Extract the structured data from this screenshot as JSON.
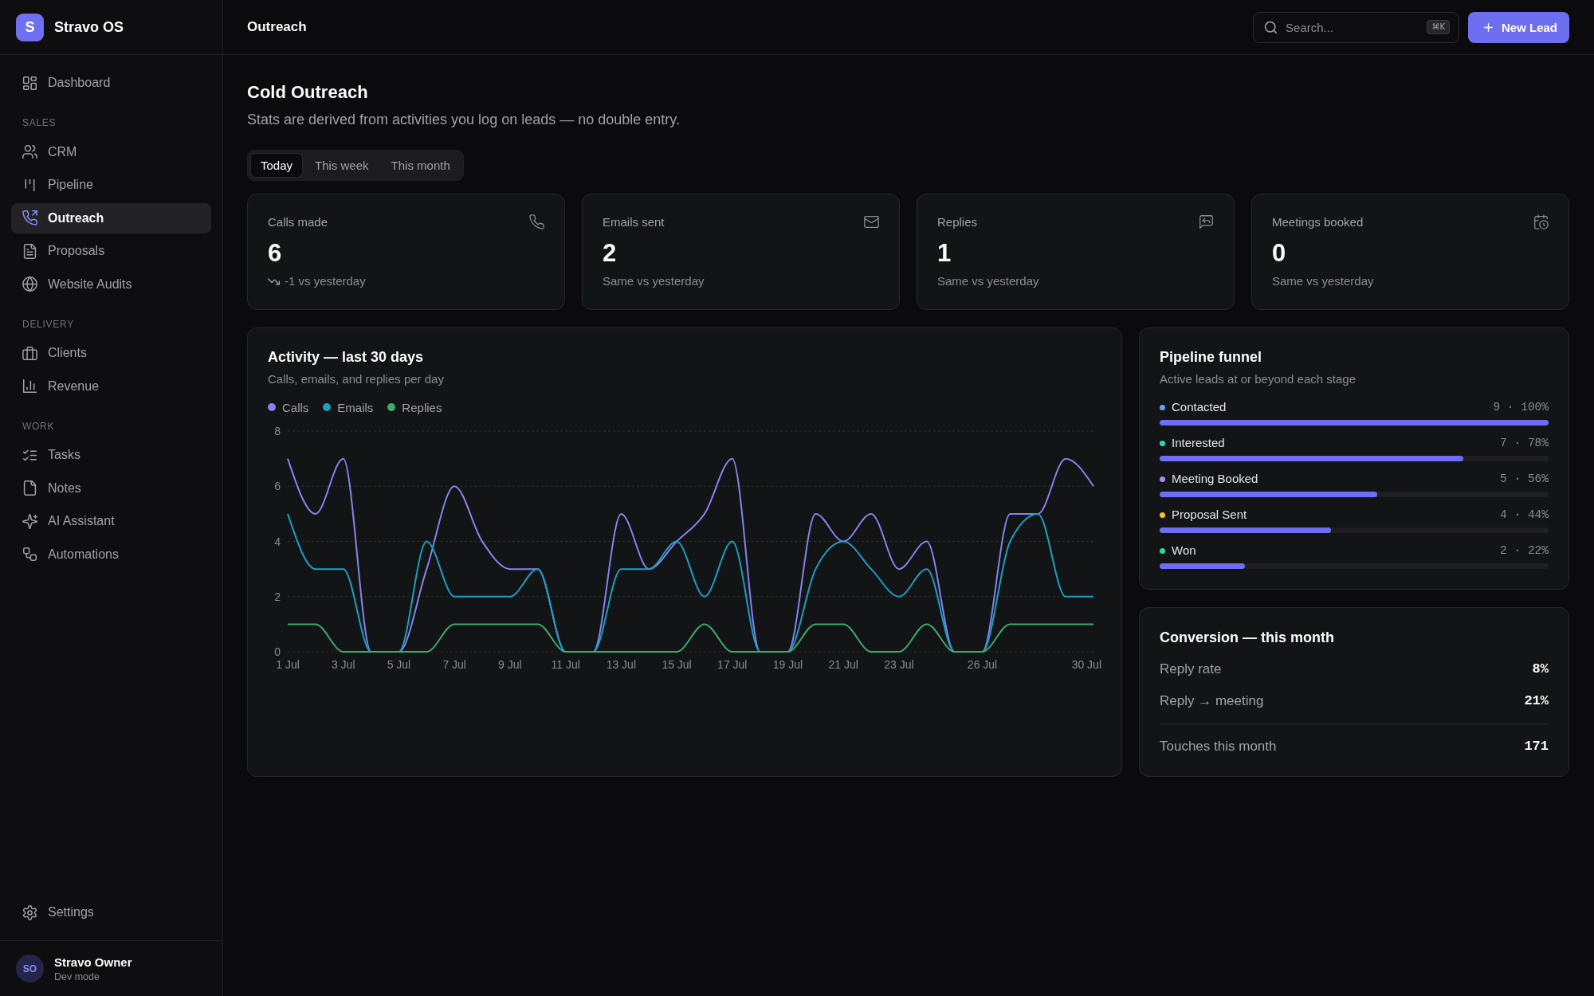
{
  "sidebar": {
    "brand": {
      "logo_letter": "S",
      "name": "Stravo OS"
    },
    "sections": [
      {
        "items": [
          {
            "label": "Dashboard",
            "selected": false
          }
        ]
      },
      {
        "heading": "SALES",
        "items": [
          {
            "label": "CRM",
            "selected": false
          },
          {
            "label": "Pipeline",
            "selected": false
          },
          {
            "label": "Outreach",
            "selected": true
          },
          {
            "label": "Proposals",
            "selected": false
          },
          {
            "label": "Website Audits",
            "selected": false
          }
        ]
      },
      {
        "heading": "DELIVERY",
        "items": [
          {
            "label": "Clients",
            "selected": false
          },
          {
            "label": "Revenue",
            "selected": false
          }
        ]
      },
      {
        "heading": "WORK",
        "items": [
          {
            "label": "Tasks",
            "selected": false
          },
          {
            "label": "Notes",
            "selected": false
          },
          {
            "label": "AI Assistant",
            "selected": false
          },
          {
            "label": "Automations",
            "selected": false
          }
        ]
      }
    ],
    "footer_items": [
      {
        "label": "Settings",
        "selected": false
      }
    ],
    "user": {
      "initials": "SO",
      "name": "Stravo Owner",
      "subtitle": "Dev mode"
    }
  },
  "top_bar": {
    "title": "Outreach",
    "search": {
      "placeholder": "Search...",
      "shortcut": "⌘K"
    },
    "new_button": {
      "label": "New Lead"
    }
  },
  "page": {
    "title": "Cold Outreach",
    "subtitle": "Stats are derived from activities you log on leads — no double entry.",
    "period_tabs": [
      {
        "label": "Today",
        "selected": true
      },
      {
        "label": "This week",
        "selected": false
      },
      {
        "label": "This month",
        "selected": false
      }
    ]
  },
  "stats": [
    {
      "label": "Calls made",
      "value": "6",
      "comparison": "-1 vs yesterday",
      "trending_down": true
    },
    {
      "label": "Emails sent",
      "value": "2",
      "comparison": "Same vs yesterday",
      "trending_down": false
    },
    {
      "label": "Replies",
      "value": "1",
      "comparison": "Same vs yesterday",
      "trending_down": false
    },
    {
      "label": "Meetings booked",
      "value": "0",
      "comparison": "Same vs yesterday",
      "trending_down": false
    }
  ],
  "activity": {
    "subtitle": "Calls, emails, and replies per day",
    "chart_data": {
      "type": "line",
      "title": "Activity — last 30 days",
      "categories": [
        "1 Jul",
        null,
        "3 Jul",
        null,
        "5 Jul",
        null,
        "7 Jul",
        null,
        "9 Jul",
        null,
        "11 Jul",
        null,
        "13 Jul",
        null,
        "15 Jul",
        null,
        "17 Jul",
        null,
        "19 Jul",
        null,
        "21 Jul",
        null,
        "23 Jul",
        null,
        null,
        "26 Jul",
        null,
        null,
        null,
        "30 Jul"
      ],
      "series": [
        {
          "name": "Calls",
          "color": "#8583ef",
          "values": [
            7,
            5,
            7,
            0,
            0,
            3,
            6,
            4,
            3,
            3,
            0,
            0,
            5,
            3,
            4,
            5,
            7,
            0,
            0,
            5,
            4,
            5,
            3,
            4,
            0,
            0,
            5,
            5,
            7,
            6
          ]
        },
        {
          "name": "Emails",
          "color": "#1d9fc2",
          "values": [
            5,
            3,
            3,
            0,
            0,
            4,
            2,
            2,
            2,
            3,
            0,
            0,
            3,
            3,
            4,
            2,
            4,
            0,
            0,
            3,
            4,
            3,
            2,
            3,
            0,
            0,
            4,
            5,
            2,
            2
          ]
        },
        {
          "name": "Replies",
          "color": "#3dab6a",
          "values": [
            1,
            1,
            0,
            0,
            0,
            0,
            1,
            1,
            1,
            1,
            0,
            0,
            0,
            0,
            0,
            1,
            0,
            0,
            0,
            1,
            1,
            0,
            0,
            1,
            0,
            0,
            1,
            1,
            1,
            1
          ]
        }
      ],
      "ylim": [
        0,
        8
      ],
      "yticks": [
        0,
        2,
        4,
        6,
        8
      ],
      "grid": true
    }
  },
  "funnel": {
    "title": "Pipeline funnel",
    "subtitle": "Active leads at or beyond each stage",
    "stages": [
      {
        "name": "Contacted",
        "color": "#60a5fa",
        "reading": "9 · 100%",
        "level": 1.0
      },
      {
        "name": "Interested",
        "color": "#2dd4bf",
        "reading": "7 · 78%",
        "level": 0.78
      },
      {
        "name": "Meeting Booked",
        "color": "#a78bfa",
        "reading": "5 · 56%",
        "level": 0.56
      },
      {
        "name": "Proposal Sent",
        "color": "#fbbf24",
        "reading": "4 · 44%",
        "level": 0.44
      },
      {
        "name": "Won",
        "color": "#34d399",
        "reading": "2 · 22%",
        "level": 0.22
      }
    ]
  },
  "conversion": {
    "title": "Conversion — this month",
    "metrics": [
      {
        "kind": "rate",
        "label": "Reply rate",
        "value": "8%"
      },
      {
        "kind": "rate",
        "label": "Reply → meeting",
        "value": "21%"
      },
      {
        "kind": "total",
        "label": "Touches this month",
        "value": "171"
      }
    ]
  }
}
